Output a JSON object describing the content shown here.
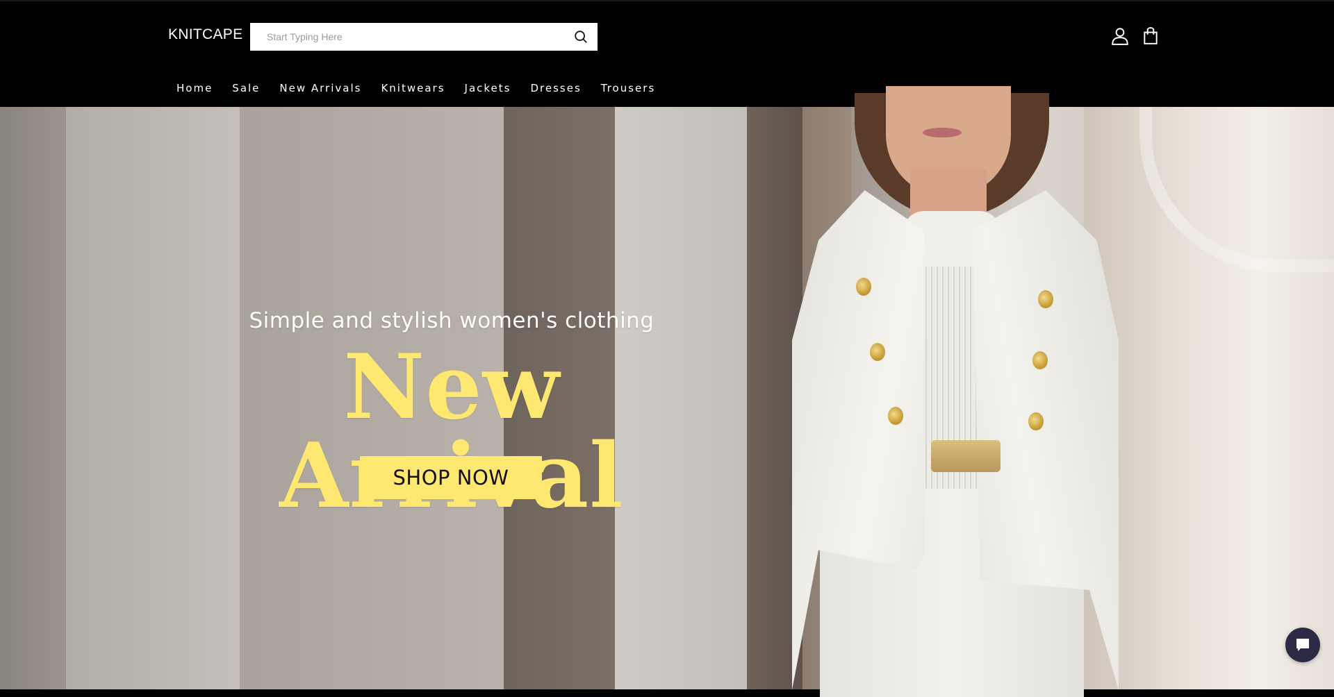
{
  "header": {
    "logo": "KNITCAPE",
    "search_placeholder": "Start Typing Here",
    "account_icon": "user-icon",
    "cart_icon": "shopping-bag-icon",
    "search_icon": "search-icon"
  },
  "nav": {
    "items": [
      "Home",
      "Sale",
      "New Arrivals",
      "Knitwears",
      "Jackets",
      "Dresses",
      "Trousers"
    ]
  },
  "hero": {
    "subtitle": "Simple and stylish women's clothing",
    "headline": "New Arrival",
    "cta_label": "SHOP NOW",
    "accent_color": "#ffe872"
  },
  "chat": {
    "icon": "chat-bubble-icon"
  }
}
